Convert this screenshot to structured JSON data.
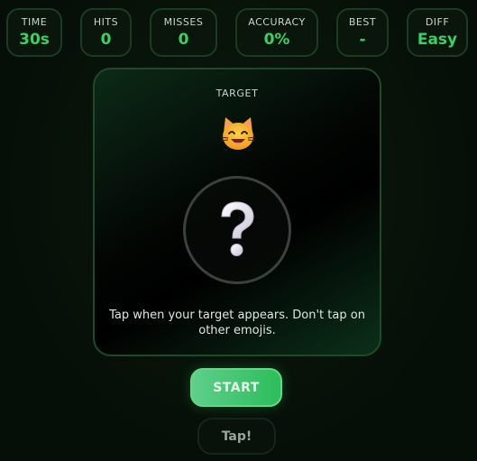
{
  "stats": [
    {
      "label": "TIME",
      "value": "30s"
    },
    {
      "label": "HITS",
      "value": "0"
    },
    {
      "label": "MISSES",
      "value": "0"
    },
    {
      "label": "ACCURACY",
      "value": "0%"
    },
    {
      "label": "BEST",
      "value": "-"
    },
    {
      "label": "DIFF",
      "value": "Easy"
    }
  ],
  "card": {
    "target_label": "TARGET",
    "target_emoji": "cat-face-icon",
    "placeholder_icon": "question-mark-icon",
    "instructions": "Tap when your target appears. Don't tap on other emojis."
  },
  "buttons": {
    "start_label": "START",
    "tap_label": "Tap!"
  },
  "colors": {
    "accent": "#35d364",
    "start_button": "#2dbd5c",
    "card_border": "#1f4a29",
    "background": "#071208"
  }
}
